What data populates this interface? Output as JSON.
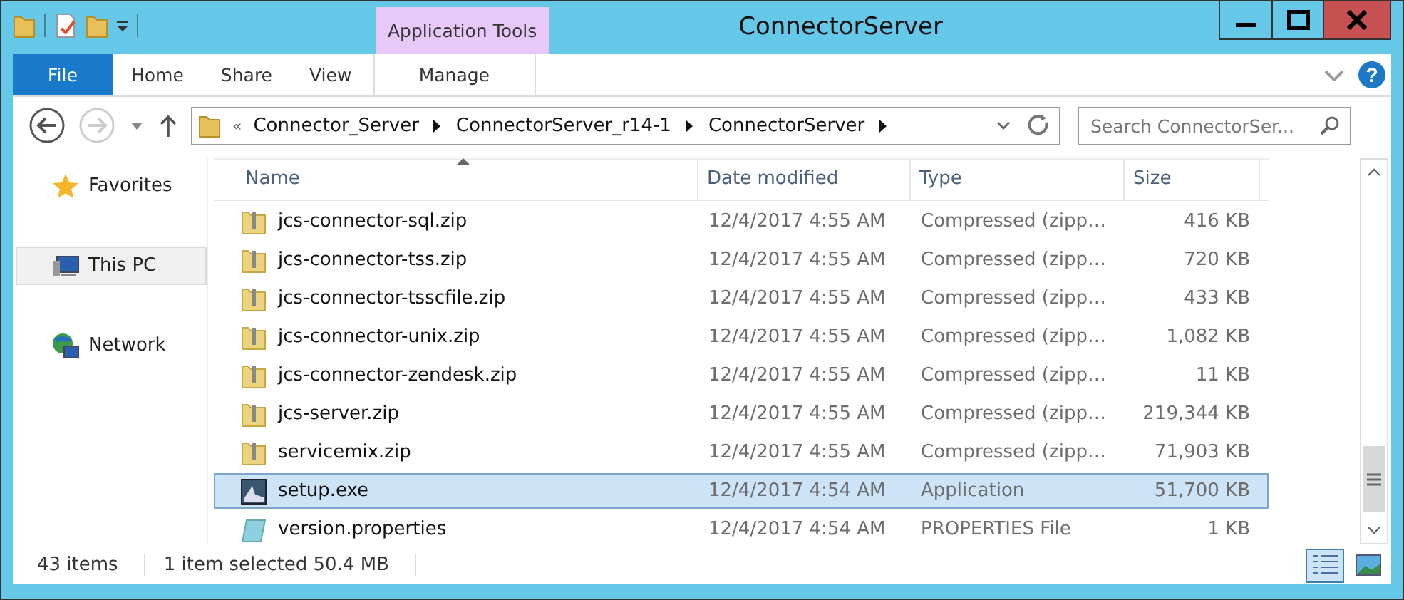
{
  "window": {
    "title": "ConnectorServer"
  },
  "context_tab": {
    "group": "Application Tools",
    "label": "Manage"
  },
  "ribbon_tabs": [
    {
      "label": "File",
      "selected": true
    },
    {
      "label": "Home",
      "selected": false
    },
    {
      "label": "Share",
      "selected": false
    },
    {
      "label": "View",
      "selected": false
    }
  ],
  "address": {
    "prefix": "«",
    "segments": [
      "Connector_Server",
      "ConnectorServer_r14-1",
      "ConnectorServer"
    ]
  },
  "help": {
    "label": "?"
  },
  "search": {
    "placeholder": "Search ConnectorSer..."
  },
  "sidebar": {
    "items": [
      {
        "label": "Favorites",
        "kind": "favorites",
        "selected": false
      },
      {
        "label": "This PC",
        "kind": "pc",
        "selected": true
      },
      {
        "label": "Network",
        "kind": "network",
        "selected": false
      }
    ]
  },
  "table": {
    "columns": [
      "Name",
      "Date modified",
      "Type",
      "Size"
    ],
    "rows": [
      {
        "kind": "zip",
        "name": "jcs-connector-sql.zip",
        "date": "12/4/2017 4:55 AM",
        "type": "Compressed (zipp…",
        "size": "416 KB",
        "selected": false
      },
      {
        "kind": "zip",
        "name": "jcs-connector-tss.zip",
        "date": "12/4/2017 4:55 AM",
        "type": "Compressed (zipp…",
        "size": "720 KB",
        "selected": false
      },
      {
        "kind": "zip",
        "name": "jcs-connector-tsscfile.zip",
        "date": "12/4/2017 4:55 AM",
        "type": "Compressed (zipp…",
        "size": "433 KB",
        "selected": false
      },
      {
        "kind": "zip",
        "name": "jcs-connector-unix.zip",
        "date": "12/4/2017 4:55 AM",
        "type": "Compressed (zipp…",
        "size": "1,082 KB",
        "selected": false
      },
      {
        "kind": "zip",
        "name": "jcs-connector-zendesk.zip",
        "date": "12/4/2017 4:55 AM",
        "type": "Compressed (zipp…",
        "size": "11 KB",
        "selected": false
      },
      {
        "kind": "zip",
        "name": "jcs-server.zip",
        "date": "12/4/2017 4:55 AM",
        "type": "Compressed (zipp…",
        "size": "219,344 KB",
        "selected": false
      },
      {
        "kind": "zip",
        "name": "servicemix.zip",
        "date": "12/4/2017 4:55 AM",
        "type": "Compressed (zipp…",
        "size": "71,903 KB",
        "selected": false
      },
      {
        "kind": "exe",
        "name": "setup.exe",
        "date": "12/4/2017 4:54 AM",
        "type": "Application",
        "size": "51,700 KB",
        "selected": true
      },
      {
        "kind": "properties",
        "name": "version.properties",
        "date": "12/4/2017 4:54 AM",
        "type": "PROPERTIES File",
        "size": "1 KB",
        "selected": false
      }
    ]
  },
  "status_bar": {
    "count": "43 items",
    "selection": "1 item selected  50.4 MB"
  }
}
